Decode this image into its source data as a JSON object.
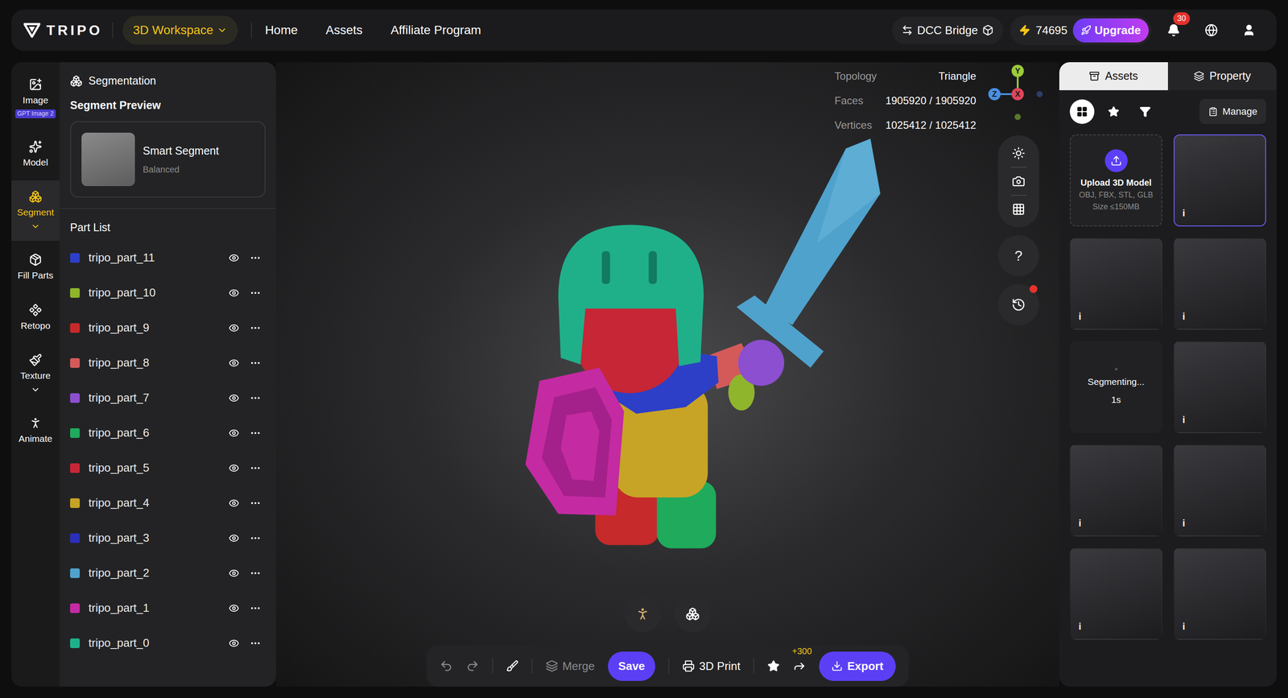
{
  "topbar": {
    "logo": "TRIPO",
    "workspace": "3D Workspace",
    "nav": [
      {
        "label": "Home"
      },
      {
        "label": "Assets"
      },
      {
        "label": "Affiliate Program"
      }
    ],
    "dcc_bridge": "DCC Bridge",
    "credits": "74695",
    "upgrade": "Upgrade",
    "notifications": "30"
  },
  "tools": [
    {
      "kind": "image",
      "label": "Image",
      "badge": "GPT Image 2",
      "selected": false,
      "expandable": false
    },
    {
      "kind": "model",
      "label": "Model",
      "badge": "",
      "selected": false,
      "expandable": false
    },
    {
      "kind": "segment",
      "label": "Segment",
      "badge": "",
      "selected": true,
      "expandable": true
    },
    {
      "kind": "fill",
      "label": "Fill Parts",
      "badge": "",
      "selected": false,
      "expandable": false
    },
    {
      "kind": "retopo",
      "label": "Retopo",
      "badge": "",
      "selected": false,
      "expandable": false
    },
    {
      "kind": "texture",
      "label": "Texture",
      "badge": "",
      "selected": false,
      "expandable": true
    },
    {
      "kind": "animate",
      "label": "Animate",
      "badge": "",
      "selected": false,
      "expandable": false
    }
  ],
  "segmentation": {
    "title": "Segmentation",
    "preview_heading": "Segment Preview",
    "preview": {
      "title": "Smart Segment",
      "subtitle": "Balanced"
    },
    "part_list_heading": "Part List",
    "parts": [
      {
        "name": "tripo_part_11",
        "color": "#2d3fc7",
        "visible": true
      },
      {
        "name": "tripo_part_10",
        "color": "#8fb52c",
        "visible": true
      },
      {
        "name": "tripo_part_9",
        "color": "#c62a2a",
        "visible": true
      },
      {
        "name": "tripo_part_8",
        "color": "#d45a5a",
        "visible": true
      },
      {
        "name": "tripo_part_7",
        "color": "#8b4fcf",
        "visible": true
      },
      {
        "name": "tripo_part_6",
        "color": "#1faa5c",
        "visible": true
      },
      {
        "name": "tripo_part_5",
        "color": "#c62636",
        "visible": true
      },
      {
        "name": "tripo_part_4",
        "color": "#c7a426",
        "visible": true
      },
      {
        "name": "tripo_part_3",
        "color": "#2a2fb8",
        "visible": true
      },
      {
        "name": "tripo_part_2",
        "color": "#4fa2cc",
        "visible": true
      },
      {
        "name": "tripo_part_1",
        "color": "#c42aa2",
        "visible": true
      },
      {
        "name": "tripo_part_0",
        "color": "#1fb08a",
        "visible": true
      }
    ]
  },
  "viewport": {
    "stats": [
      {
        "label": "Topology",
        "value": "Triangle"
      },
      {
        "label": "Faces",
        "value": "1905920 / 1905920"
      },
      {
        "label": "Vertices",
        "value": "1025412 / 1025412"
      }
    ],
    "axes": {
      "y": "Y",
      "z": "Z",
      "x": "X"
    },
    "help": "?",
    "history_alert": true
  },
  "toolbar": {
    "merge": {
      "label": "Merge",
      "disabled": true
    },
    "save": "Save",
    "print": "3D Print",
    "share_bonus": "+300",
    "export": "Export"
  },
  "assets_panel": {
    "tabs": [
      {
        "label": "Assets",
        "selected": true
      },
      {
        "label": "Property",
        "selected": false
      }
    ],
    "filters": [
      {
        "kind": "all",
        "selected": true
      },
      {
        "kind": "favorites",
        "selected": false
      },
      {
        "kind": "filter",
        "selected": false
      }
    ],
    "manage": "Manage",
    "upload": {
      "title": "Upload 3D Model",
      "formats": "OBJ, FBX, STL, GLB",
      "size": "Size ≤150MB"
    },
    "items": [
      {
        "kind": "image",
        "info": "i",
        "selected": true
      },
      {
        "kind": "image",
        "info": "i",
        "selected": false
      },
      {
        "kind": "image",
        "info": "i",
        "selected": false
      },
      {
        "kind": "progress",
        "status": "Segmenting...",
        "time": "1s",
        "selected": false
      },
      {
        "kind": "image",
        "info": "i",
        "selected": false
      },
      {
        "kind": "image",
        "info": "i",
        "selected": false
      },
      {
        "kind": "image",
        "info": "i",
        "selected": false
      },
      {
        "kind": "image",
        "info": "i",
        "selected": false
      },
      {
        "kind": "image",
        "info": "i",
        "selected": false
      }
    ]
  }
}
